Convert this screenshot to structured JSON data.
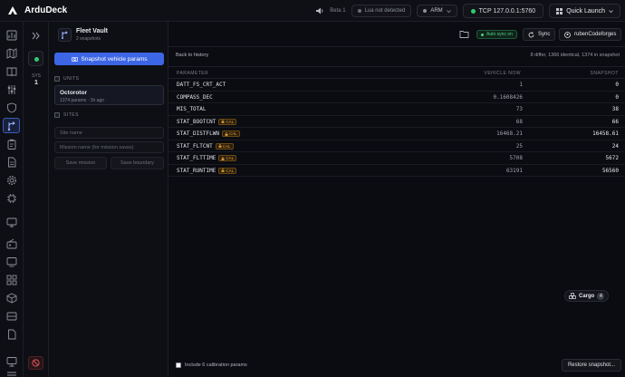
{
  "app": {
    "title": "ArduDeck"
  },
  "topbar": {
    "beta": "Beta 1",
    "lua_status": "Lua not detected",
    "arm_label": "ARM",
    "connection": "TCP 127.0.0.1:5760",
    "quick_launch": "Quick Launch"
  },
  "sidebar2": {
    "sys_label": "SYS",
    "sys_value": "1"
  },
  "panel": {
    "title": "Fleet Vault",
    "subtitle": "2 snapshots",
    "snapshot_button": "Snapshot vehicle params",
    "units_label": "UNITS",
    "unit": {
      "name": "Octorotor",
      "meta": "1374 params · 1h ago"
    },
    "sites_label": "SITES",
    "site_placeholder": "Site name",
    "mission_placeholder": "Mission name (for mission saves)",
    "save_mission": "Save mission",
    "save_boundary": "Save boundary"
  },
  "main": {
    "auto_sync": "Auto sync on",
    "sync": "Sync",
    "user": "rubenCodeforges",
    "back": "Back to history",
    "summary": "8 differ, 1366 identical, 1374 in snapshot",
    "columns": {
      "param": "PARAMETER",
      "vehicle": "VEHICLE NOW",
      "snapshot": "SNAPSHOT"
    },
    "cal_tag": "CAL",
    "rows": [
      {
        "param": "DATT_FS_CRT_ACT",
        "vehicle": "1",
        "snapshot": "0",
        "cal": false
      },
      {
        "param": "COMPASS_DEC",
        "vehicle": "0.1608426",
        "snapshot": "0",
        "cal": false
      },
      {
        "param": "MIS_TOTAL",
        "vehicle": "73",
        "snapshot": "38",
        "cal": false
      },
      {
        "param": "STAT_BOOTCNT",
        "vehicle": "68",
        "snapshot": "66",
        "cal": true
      },
      {
        "param": "STAT_DISTFLWN",
        "vehicle": "16468.21",
        "snapshot": "16458.61",
        "cal": true
      },
      {
        "param": "STAT_FLTCNT",
        "vehicle": "25",
        "snapshot": "24",
        "cal": true
      },
      {
        "param": "STAT_FLTTIME",
        "vehicle": "5708",
        "snapshot": "5672",
        "cal": true
      },
      {
        "param": "STAT_RUNTIME",
        "vehicle": "63191",
        "snapshot": "56560",
        "cal": true
      }
    ],
    "cargo": {
      "label": "Cargo",
      "count": "4"
    },
    "footer_checkbox": "Include 6 calibration params",
    "restore": "Restore snapshot..."
  }
}
